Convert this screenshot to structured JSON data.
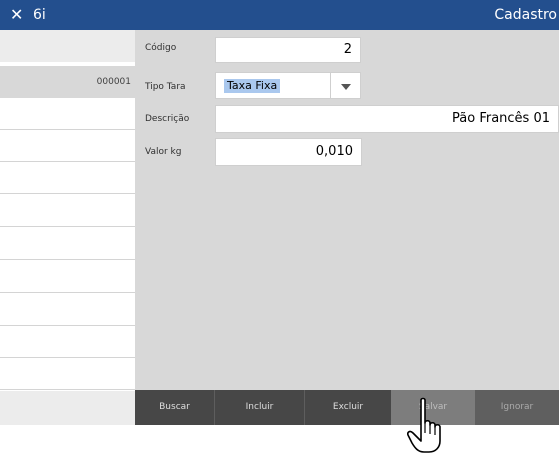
{
  "titlebar": {
    "close_icon": "close-icon",
    "app_name": "6i",
    "window_title": "Cadastro",
    "background": "#234f8e"
  },
  "left_list": {
    "rows": [
      {
        "label": ""
      },
      {
        "label": "000001"
      },
      {
        "label": ""
      },
      {
        "label": ""
      },
      {
        "label": ""
      },
      {
        "label": ""
      },
      {
        "label": ""
      },
      {
        "label": ""
      },
      {
        "label": ""
      },
      {
        "label": ""
      },
      {
        "label": ""
      },
      {
        "label": ""
      }
    ]
  },
  "form": {
    "codigo": {
      "label": "Código",
      "value": "2"
    },
    "tipo_tara": {
      "label": "Tipo Tara",
      "value": "Taxa Fixa"
    },
    "descricao": {
      "label": "Descrição",
      "value": "Pão Francês 01"
    },
    "valor_kg": {
      "label": "Valor kg",
      "value": "0,010"
    }
  },
  "buttons": {
    "buscar": "Buscar",
    "incluir": "Incluir",
    "excluir": "Excluir",
    "salvar": "Salvar",
    "ignorar": "Ignorar"
  },
  "cursor": "hand-pointer-icon"
}
